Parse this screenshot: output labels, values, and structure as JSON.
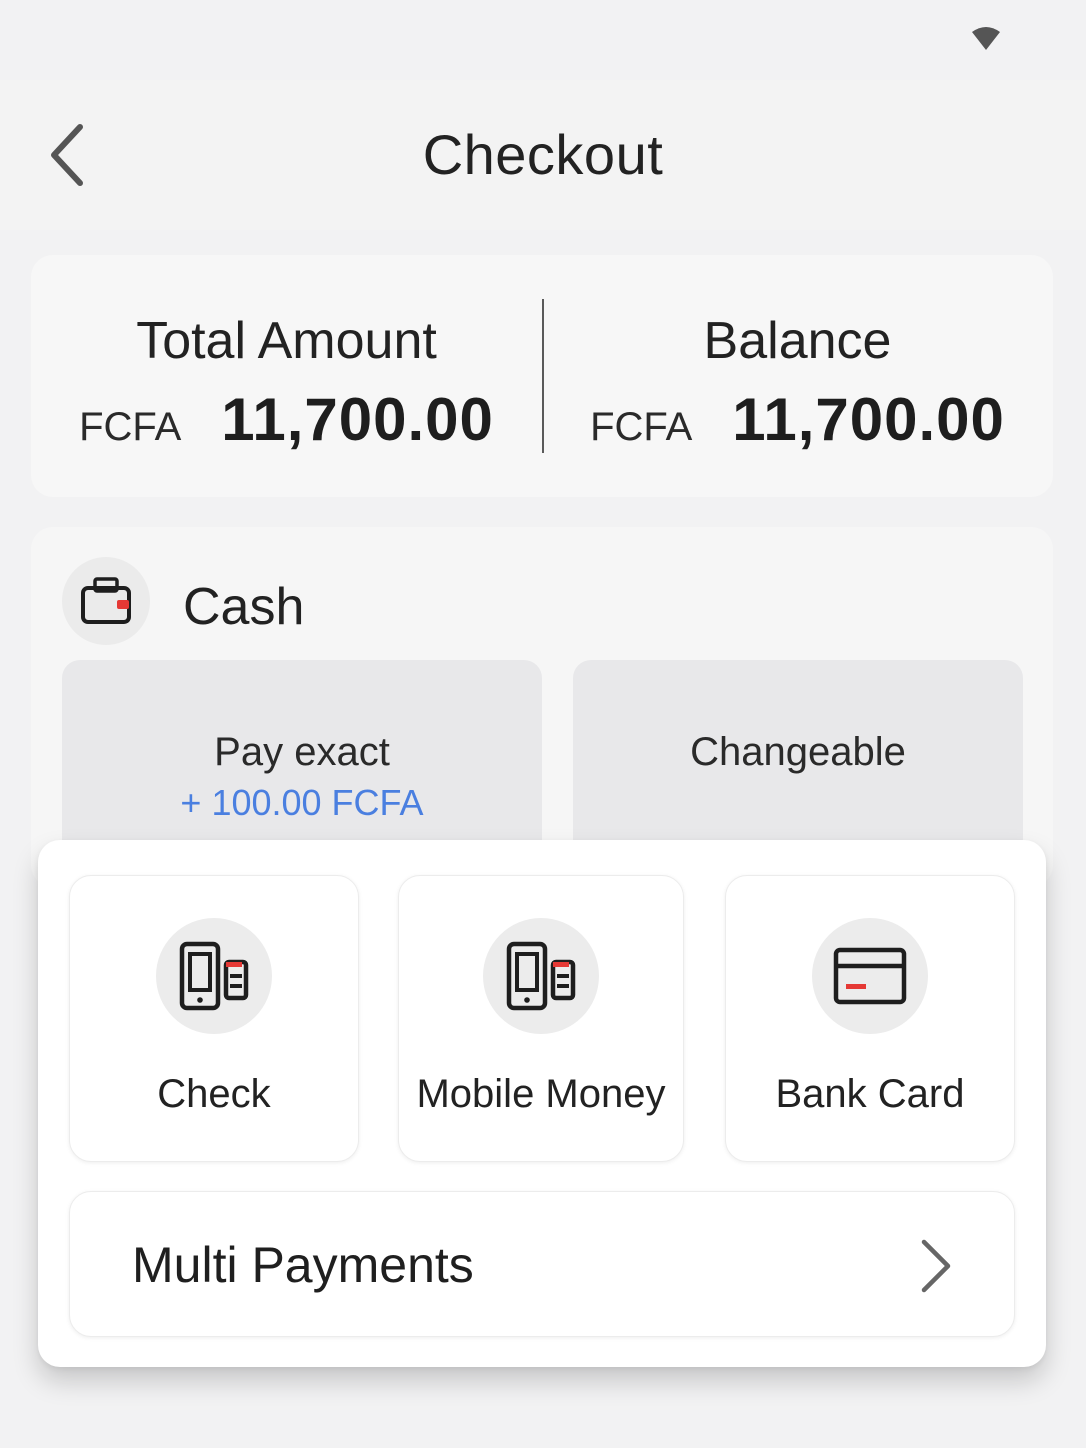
{
  "header": {
    "title": "Checkout",
    "back_icon": "chevron-left-icon",
    "status_icon": "wifi-icon"
  },
  "summary": {
    "total": {
      "label": "Total Amount",
      "currency": "FCFA",
      "value": "11,700.00"
    },
    "balance": {
      "label": "Balance",
      "currency": "FCFA",
      "value": "11,700.00"
    }
  },
  "cash": {
    "label": "Cash",
    "icon": "wallet-icon",
    "options": [
      {
        "label": "Pay exact",
        "sub": "+ 100.00 FCFA"
      },
      {
        "label": "Changeable"
      }
    ]
  },
  "methods": [
    {
      "label": "Check",
      "icon": "phone-check-icon"
    },
    {
      "label": "Mobile Money",
      "icon": "mobile-money-icon"
    },
    {
      "label": "Bank Card",
      "icon": "bank-card-icon"
    }
  ],
  "multi_payments": {
    "label": "Multi Payments",
    "icon": "chevron-right-icon"
  },
  "colors": {
    "background": "#f2f2f3",
    "accent_blue": "#4a7fe0",
    "accent_red": "#e53935",
    "text": "#1f1f1f"
  }
}
